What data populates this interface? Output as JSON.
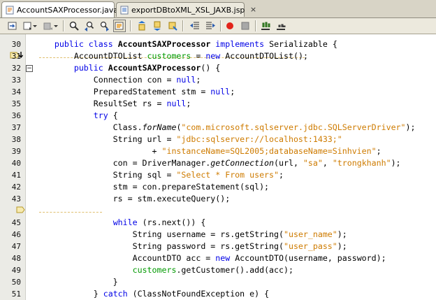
{
  "tabs": [
    {
      "label": "AccountSAXProcessor.java",
      "active": true
    },
    {
      "label": "exportDBtoXML_XSL_JAXB.jsp",
      "active": false
    }
  ],
  "toolbar_icons": [
    "last-edit-icon",
    "back-icon",
    "forward-icon",
    "find-selection-icon",
    "find-previous-icon",
    "find-next-icon",
    "toggle-highlight-icon",
    "previous-bookmark-icon",
    "next-bookmark-icon",
    "toggle-bookmark-icon",
    "shift-left-icon",
    "shift-right-icon",
    "start-macro-icon",
    "stop-macro-icon",
    "comment-icon",
    "uncomment-icon"
  ],
  "colors": {
    "keyword": "#0000e6",
    "string": "#ce7b00",
    "field": "#009900"
  },
  "lines": [
    {
      "n": "30",
      "tokens": [
        {
          "t": "    "
        },
        {
          "t": "public",
          "c": "kw"
        },
        {
          "t": " "
        },
        {
          "t": "class",
          "c": "kw"
        },
        {
          "t": " "
        },
        {
          "t": "AccountSAXProcessor",
          "c": "b"
        },
        {
          "t": " "
        },
        {
          "t": "implements",
          "c": "kw"
        },
        {
          "t": " Serializable {"
        }
      ]
    },
    {
      "n": "31",
      "tokens": [
        {
          "t": "        AccountDTOList "
        },
        {
          "t": "customers",
          "c": "fld"
        },
        {
          "t": " = "
        },
        {
          "t": "new",
          "c": "kw"
        },
        {
          "t": " AccountDTOList();"
        }
      ]
    },
    {
      "n": "32",
      "tokens": [
        {
          "t": "        "
        },
        {
          "t": "public",
          "c": "kw"
        },
        {
          "t": " "
        },
        {
          "t": "AccountSAXProcessor",
          "c": "b"
        },
        {
          "t": "() {"
        }
      ]
    },
    {
      "n": "33",
      "tokens": [
        {
          "t": "            Connection con = "
        },
        {
          "t": "null",
          "c": "kw"
        },
        {
          "t": ";"
        }
      ]
    },
    {
      "n": "34",
      "tokens": [
        {
          "t": "            PreparedStatement stm = "
        },
        {
          "t": "null",
          "c": "kw"
        },
        {
          "t": ";"
        }
      ]
    },
    {
      "n": "35",
      "tokens": [
        {
          "t": "            ResultSet rs = "
        },
        {
          "t": "null",
          "c": "kw"
        },
        {
          "t": ";"
        }
      ]
    },
    {
      "n": "36",
      "tokens": [
        {
          "t": "            "
        },
        {
          "t": "try",
          "c": "kw"
        },
        {
          "t": " {"
        }
      ]
    },
    {
      "n": "37",
      "tokens": [
        {
          "t": "                Class."
        },
        {
          "t": "forName",
          "c": "it"
        },
        {
          "t": "("
        },
        {
          "t": "\"com.microsoft.sqlserver.jdbc.SQLServerDriver\"",
          "c": "str"
        },
        {
          "t": ");"
        }
      ]
    },
    {
      "n": "38",
      "tokens": [
        {
          "t": "                String url = "
        },
        {
          "t": "\"jdbc:sqlserver://localhost:1433;\"",
          "c": "str"
        }
      ]
    },
    {
      "n": "39",
      "tokens": [
        {
          "t": "                        + "
        },
        {
          "t": "\"instanceName=SQL2005;databaseName=Sinhvien\"",
          "c": "str"
        },
        {
          "t": ";"
        }
      ]
    },
    {
      "n": "40",
      "tokens": [
        {
          "t": "                con = DriverManager."
        },
        {
          "t": "getConnection",
          "c": "it"
        },
        {
          "t": "(url, "
        },
        {
          "t": "\"sa\"",
          "c": "str"
        },
        {
          "t": ", "
        },
        {
          "t": "\"trongkhanh\"",
          "c": "str"
        },
        {
          "t": ");"
        }
      ]
    },
    {
      "n": "41",
      "tokens": [
        {
          "t": "                String sql = "
        },
        {
          "t": "\"Select * From users\"",
          "c": "str"
        },
        {
          "t": ";"
        }
      ]
    },
    {
      "n": "42",
      "tokens": [
        {
          "t": "                stm = con.prepareStatement(sql);"
        }
      ]
    },
    {
      "n": "43",
      "tokens": [
        {
          "t": "                rs = stm.executeQuery();"
        }
      ]
    },
    {
      "n": "",
      "tokens": [
        {
          "t": ""
        }
      ]
    },
    {
      "n": "45",
      "tokens": [
        {
          "t": "                "
        },
        {
          "t": "while",
          "c": "kw"
        },
        {
          "t": " (rs.next()) {"
        }
      ]
    },
    {
      "n": "46",
      "tokens": [
        {
          "t": "                    String username = rs.getString("
        },
        {
          "t": "\"user_name\"",
          "c": "str"
        },
        {
          "t": ");"
        }
      ]
    },
    {
      "n": "47",
      "tokens": [
        {
          "t": "                    String password = rs.getString("
        },
        {
          "t": "\"user_pass\"",
          "c": "str"
        },
        {
          "t": ");"
        }
      ]
    },
    {
      "n": "48",
      "tokens": [
        {
          "t": "                    AccountDTO acc = "
        },
        {
          "t": "new",
          "c": "kw"
        },
        {
          "t": " AccountDTO(username, password);"
        }
      ]
    },
    {
      "n": "49",
      "tokens": [
        {
          "t": "                    "
        },
        {
          "t": "customers",
          "c": "fld"
        },
        {
          "t": ".getCustomer().add(acc);"
        }
      ]
    },
    {
      "n": "50",
      "tokens": [
        {
          "t": "                }"
        }
      ]
    },
    {
      "n": "51",
      "tokens": [
        {
          "t": "            } "
        },
        {
          "t": "catch",
          "c": "kw"
        },
        {
          "t": " (ClassNotFoundException e) {"
        }
      ]
    }
  ]
}
